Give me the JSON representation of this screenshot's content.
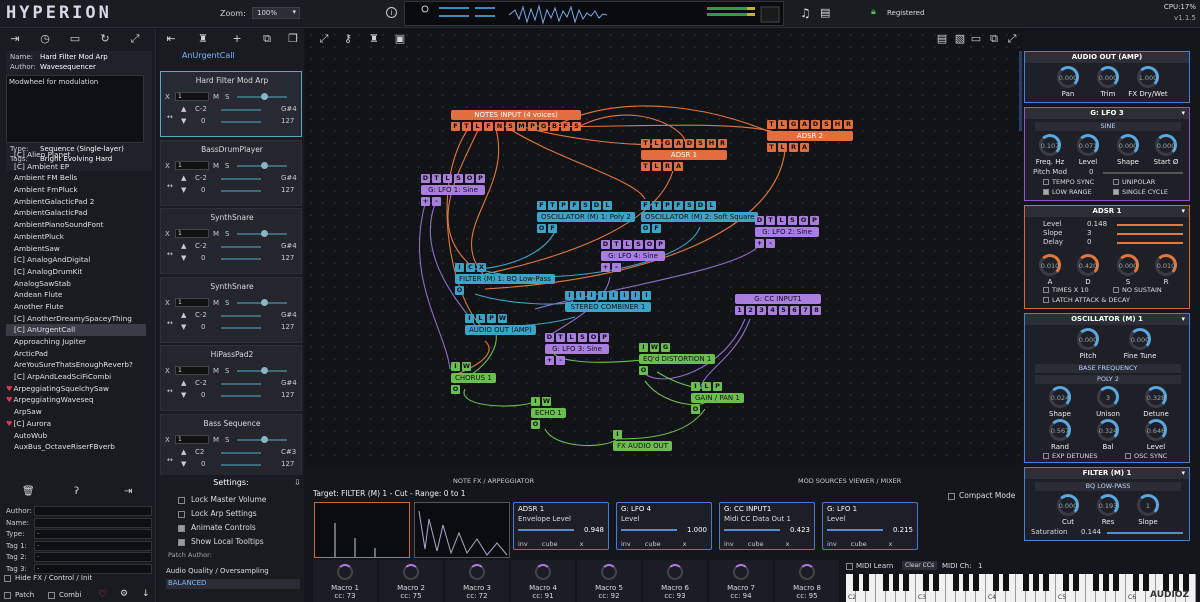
{
  "app": {
    "logo": "HYPERION",
    "zoom_label": "Zoom:",
    "zoom_value": "100%",
    "registered": "Registered",
    "cpu": "CPU:17%",
    "version": "v1.1.5"
  },
  "patch_info": {
    "name_label": "Name:",
    "name": "Hard Filter Mod Arp",
    "author_label": "Author:",
    "author": "Wavesequencer",
    "description": "Modwheel for modulation",
    "type_label": "Type:",
    "type": "Sequence  (Single-layer)",
    "tags_label": "Tags:",
    "tags": "Bright Evolving Hard"
  },
  "patches": [
    "[C] Alien Planet",
    "[C] Ambient EP",
    "Ambient FM Bells",
    "Ambient FmPluck",
    "AmbientGalacticPad 2",
    "AmbientGalacticPad",
    "AmbientPianoSoundFont",
    "AmbientPluck",
    "AmbientSaw",
    "[C] AnalogAndDigital",
    "[C] AnalogDrumKit",
    "AnalogSawStab",
    "Andean Flute",
    "Another Flute",
    "[C] AnotherDreamySpaceyThing",
    "[C] AnUrgentCall",
    "Approaching Jupiter",
    "ArcticPad",
    "AreYouSureThatsEnoughReverb?",
    "[C] ArpAndLeadSciFiCombi",
    "ArpeggiatingSquelchySaw",
    "ArpeggiatingWaveseq",
    "ArpSaw",
    "[C] Aurora",
    "AutoWub",
    "AuxBus_OctaveRiserFBverb"
  ],
  "patch_selected": 15,
  "patch_hearts": [
    20,
    21,
    23
  ],
  "author_fields": [
    {
      "label": "Author:",
      "value": ""
    },
    {
      "label": "Name:",
      "value": ""
    },
    {
      "label": "Type:",
      "value": "-"
    },
    {
      "label": "Tag 1:",
      "value": "-"
    },
    {
      "label": "Tag 2:",
      "value": "-"
    },
    {
      "label": "Tag 3:",
      "value": "-"
    }
  ],
  "hide_fx": "Hide FX / Control / Init",
  "bottom": {
    "patch": "Patch",
    "combi": "Combi"
  },
  "sequencer": {
    "header": "AnUrgentCall",
    "slots": [
      {
        "title": "Hard Filter Mod Arp",
        "note_lo": "C-2",
        "note_hi": "G#4",
        "v_lo": "0",
        "v_hi": "127",
        "chan": "1"
      },
      {
        "title": "BassDrumPlayer",
        "note_lo": "C-2",
        "note_hi": "G#4",
        "v_lo": "0",
        "v_hi": "127",
        "chan": "1"
      },
      {
        "title": "SynthSnare",
        "note_lo": "C-2",
        "note_hi": "G#4",
        "v_lo": "0",
        "v_hi": "127",
        "chan": "1"
      },
      {
        "title": "SynthSnare",
        "note_lo": "C-2",
        "note_hi": "G#4",
        "v_lo": "0",
        "v_hi": "127",
        "chan": "1"
      },
      {
        "title": "HiPassPad2",
        "note_lo": "C-2",
        "note_hi": "G#4",
        "v_lo": "0",
        "v_hi": "127",
        "chan": "1"
      },
      {
        "title": "Bass Sequence",
        "note_lo": "C2",
        "note_hi": "C#3",
        "v_lo": "0",
        "v_hi": "127",
        "chan": "1"
      }
    ]
  },
  "settings": {
    "title": "Settings:",
    "items": [
      {
        "label": "Lock Master Volume",
        "on": false
      },
      {
        "label": "Lock Arp Settings",
        "on": false
      },
      {
        "label": "Animate Controls",
        "on": true
      },
      {
        "label": "Show Local Tooltips",
        "on": true
      }
    ],
    "patch_author": "Patch Author:",
    "quality_label": "Audio Quality / Oversampling",
    "quality_value": "BALANCED"
  },
  "nodes": [
    {
      "id": "notes-input",
      "color": "orange",
      "pins": "FTLFNSMPGBFS",
      "title": "NOTES INPUT  (4 voices)"
    },
    {
      "id": "adsr1",
      "color": "orange",
      "pins_top": "TLGADSHR",
      "title": "ADSR 1",
      "pins_bot": "TLRA"
    },
    {
      "id": "adsr2",
      "color": "orange",
      "pins_top": "TLGADSHR",
      "title": "ADSR 2",
      "pins_bot": "TLRA"
    },
    {
      "id": "lfo1",
      "color": "purple",
      "pins_top": "DTLSOP",
      "title": "G: LFO 1: Sine",
      "pins_bot": "+-"
    },
    {
      "id": "osc1",
      "color": "cyan",
      "pins_top": "FTPFSDL",
      "title": "OSCILLATOR (M) 1: Poly 2",
      "pins_bot": "OF"
    },
    {
      "id": "osc2",
      "color": "cyan",
      "pins_top": "FTPFSDL",
      "title": "OSCILLATOR (M) 2: Soft Square",
      "pins_bot": "OF"
    },
    {
      "id": "lfo2",
      "color": "purple",
      "pins_top": "DTLSOP",
      "title": "G: LFO 2: Sine",
      "pins_bot": "+-"
    },
    {
      "id": "lfo4",
      "color": "purple",
      "pins_top": "DTLSOP",
      "title": "G: LFO 4: Sine",
      "pins_bot": "+-"
    },
    {
      "id": "filter",
      "color": "cyan",
      "pins_top": "ICX",
      "title": "FILTER (M) 1: BQ Low-Pass",
      "pins_bot": "O"
    },
    {
      "id": "stereo",
      "color": "cyan",
      "pins_top": "IIIIIIII",
      "title": "STEREO COMBINER 1",
      "pins_bot": ""
    },
    {
      "id": "cc",
      "color": "purple",
      "pins_top": "",
      "title": "G: CC INPUT1",
      "pins_bot": "12345678"
    },
    {
      "id": "audio-out",
      "color": "cyan",
      "pins_top": "ILPW",
      "title": "AUDIO OUT (AMP)",
      "pins_bot": ""
    },
    {
      "id": "lfo3",
      "color": "purple",
      "pins_top": "DTLSOP",
      "title": "G: LFO 3: Sine",
      "pins_bot": "+-"
    },
    {
      "id": "distortion",
      "color": "green",
      "pins_top": "IWG",
      "title": "EQ'd DISTORTION 1",
      "pins_bot": "O"
    },
    {
      "id": "chorus",
      "color": "green",
      "pins_top": "IW",
      "title": "CHORUS 1",
      "pins_bot": "O"
    },
    {
      "id": "gainpan",
      "color": "green",
      "pins_top": "ILP",
      "title": "GAIN / PAN 1",
      "pins_bot": "O"
    },
    {
      "id": "echo",
      "color": "green",
      "pins_top": "IW",
      "title": "ECHO 1",
      "pins_bot": "O"
    },
    {
      "id": "fxout",
      "color": "green",
      "pins_top": "I",
      "title": "FX AUDIO OUT",
      "pins_bot": ""
    }
  ],
  "bottom_tabs": {
    "left": "NOTE FX / ARPEGGIATOR",
    "right": "MOD SOURCES VIEWER / MIXER"
  },
  "target": "Target: FILTER (M) 1 - Cut - Range: 0 to 1",
  "mod_cards": [
    {
      "title": "ADSR 1",
      "sub": "Envelope Level",
      "value": "0.948"
    },
    {
      "title": "G: LFO 4",
      "sub": "Level",
      "value": "1.000"
    },
    {
      "title": "G: CC INPUT1",
      "sub": "Midi CC Data Out 1",
      "value": "0.423"
    },
    {
      "title": "G: LFO 1",
      "sub": "Level",
      "value": "0.215"
    }
  ],
  "mod_flags": {
    "inv": "inv",
    "cube": "cube",
    "x": "x"
  },
  "compact_mode": "Compact Mode",
  "macros": [
    {
      "name": "Macro 1",
      "cc": "cc:  73"
    },
    {
      "name": "Macro 2",
      "cc": "cc:  75"
    },
    {
      "name": "Macro 3",
      "cc": "cc:  72"
    },
    {
      "name": "Macro 4",
      "cc": "cc:  91"
    },
    {
      "name": "Macro 5",
      "cc": "cc:  92"
    },
    {
      "name": "Macro 6",
      "cc": "cc:  93"
    },
    {
      "name": "Macro 7",
      "cc": "cc:  94"
    },
    {
      "name": "Macro 8",
      "cc": "cc:  95"
    }
  ],
  "midi": {
    "learn": "MIDI Learn",
    "clear": "Clear CCs",
    "ch_label": "MIDI Ch:",
    "ch": "1"
  },
  "keyboard": {
    "labels": [
      "C2",
      "C3",
      "C4",
      "C5",
      "C6"
    ],
    "watermark": "AUDIOZ"
  },
  "right": {
    "audio_out": {
      "title": "AUDIO OUT (AMP)",
      "knobs": [
        {
          "label": "Pan",
          "value": "0.000"
        },
        {
          "label": "Trim",
          "value": "0.000"
        },
        {
          "label": "FX Dry/Wet",
          "value": "1.000"
        }
      ]
    },
    "lfo3": {
      "title": "G: LFO 3",
      "wave": "SINE",
      "knobs": [
        {
          "label": "Freq. Hz",
          "value": "0.107"
        },
        {
          "label": "Level",
          "value": "0.071"
        },
        {
          "label": "Shape",
          "value": "0.000"
        },
        {
          "label": "Start Ø",
          "value": "0.000"
        }
      ],
      "pitch_mod_label": "Pitch Mod",
      "pitch_mod": "0",
      "checks": [
        {
          "label": "TEMPO SYNC",
          "on": false
        },
        {
          "label": "UNIPOLAR",
          "on": false
        },
        {
          "label": "LOW RANGE",
          "on": true
        },
        {
          "label": "SINGLE CYCLE",
          "on": true
        }
      ]
    },
    "adsr1": {
      "title": "ADSR 1",
      "rows": [
        {
          "label": "Level",
          "value": "0.148"
        },
        {
          "label": "Slope",
          "value": "3"
        },
        {
          "label": "Delay",
          "value": "0"
        }
      ],
      "knobs": [
        {
          "label": "A",
          "value": "0.010"
        },
        {
          "label": "D",
          "value": "0.420"
        },
        {
          "label": "S",
          "value": "0.000"
        },
        {
          "label": "R",
          "value": "0.010"
        }
      ],
      "checks": [
        {
          "label": "TIMES X 10",
          "on": false
        },
        {
          "label": "NO SUSTAIN",
          "on": false
        },
        {
          "label": "LATCH ATTACK & DECAY",
          "on": false
        }
      ]
    },
    "osc1": {
      "title": "OSCILLATOR (M) 1",
      "knobs_top": [
        {
          "label": "Pitch",
          "value": "0.000"
        },
        {
          "label": "Fine Tune",
          "value": "0.000"
        }
      ],
      "freq_mode": "BASE FREQUENCY",
      "wave": "POLY 2",
      "knobs_bot": [
        {
          "label": "Shape",
          "value": "0.024"
        },
        {
          "label": "Unison",
          "value": "3"
        },
        {
          "label": "Detune",
          "value": "0.328"
        },
        {
          "label": "Rand",
          "value": "0.567"
        },
        {
          "label": "Bal",
          "value": "0.324"
        },
        {
          "label": "Level",
          "value": "0.646"
        }
      ],
      "checks": [
        {
          "label": "EXP DETUNES",
          "on": false
        },
        {
          "label": "OSC SYNC",
          "on": false
        }
      ]
    },
    "filter1": {
      "title": "FILTER (M) 1",
      "type": "BQ LOW-PASS",
      "knobs": [
        {
          "label": "Cut",
          "value": "0.000"
        },
        {
          "label": "Res",
          "value": "0.193"
        },
        {
          "label": "Slope",
          "value": "1"
        }
      ],
      "sat_label": "Saturation",
      "sat_value": "0.144"
    }
  }
}
